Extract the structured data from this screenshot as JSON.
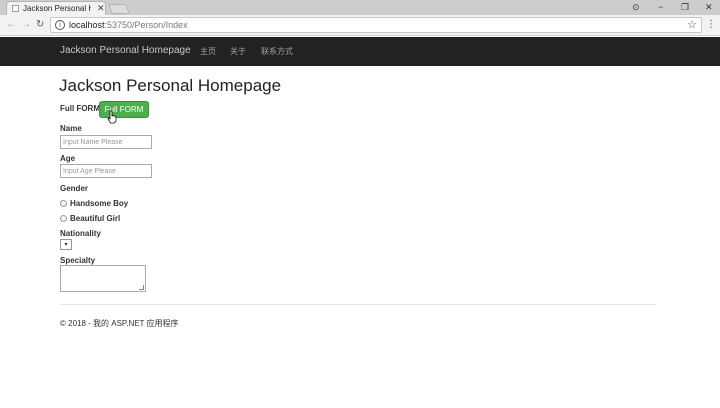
{
  "browser": {
    "tab_title": "Jackson Personal Homep",
    "tab_close": "✕",
    "url_host": "localhost",
    "url_path": ":53750/Person/Index",
    "back": "←",
    "forward": "→",
    "reload": "↻",
    "star": "☆",
    "menu": "⋮",
    "window_controls": {
      "account": "⊙",
      "minimize": "−",
      "restore": "❐",
      "close": "✕"
    }
  },
  "navbar": {
    "brand": "Jackson Personal Homepage",
    "links": [
      "主页",
      "关于",
      "联系方式"
    ]
  },
  "page": {
    "title": "Jackson Personal Homepage",
    "full_form_label": "Full FORM",
    "full_form_button": "Full FORM",
    "name_label": "Name",
    "name_placeholder": "Input Name Please",
    "age_label": "Age",
    "age_placeholder": "Input Age Please",
    "gender_label": "Gender",
    "gender_options": [
      "Handsome Boy",
      "Beautiful Girl"
    ],
    "nationality_label": "Nationality",
    "nationality_select_arrow": "▾",
    "specialty_label": "Specialty"
  },
  "footer": {
    "text": "© 2018 - 我的 ASP.NET 应用程序"
  },
  "colors": {
    "navbar_bg": "#222222",
    "button_green": "#4cae4c"
  }
}
